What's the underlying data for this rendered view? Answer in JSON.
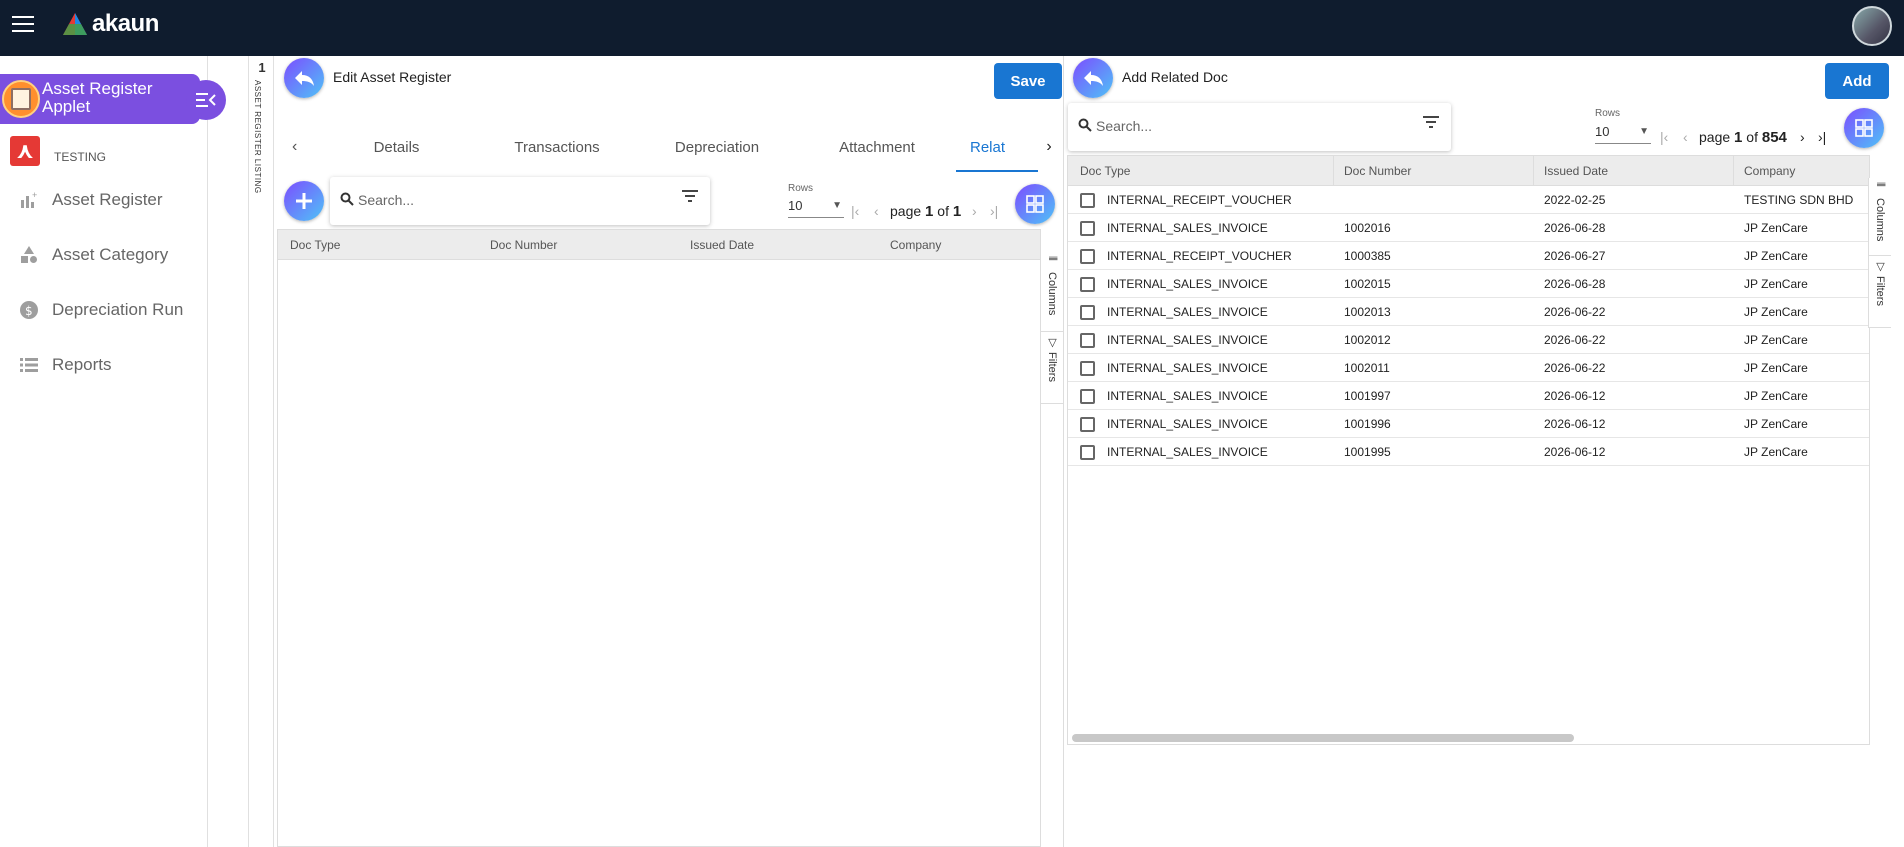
{
  "topbar": {
    "logo_text": "akaun"
  },
  "sidebar": {
    "applet_title_line1": "Asset Register",
    "applet_title_line2": "Applet",
    "org_name": "TESTING",
    "items": [
      {
        "label": "Asset Register",
        "icon": "chart-add-icon"
      },
      {
        "label": "Asset Category",
        "icon": "shapes-icon"
      },
      {
        "label": "Depreciation Run",
        "icon": "dollar-circle-icon"
      },
      {
        "label": "Reports",
        "icon": "list-icon"
      }
    ]
  },
  "listing_strip": {
    "number": "1",
    "label": "ASSET REGISTER LISTING"
  },
  "edit_panel": {
    "title": "Edit Asset Register",
    "save_label": "Save",
    "tabs": [
      "Details",
      "Transactions",
      "Depreciation",
      "Attachment",
      "Relat"
    ],
    "search_placeholder": "Search...",
    "rows_label": "Rows",
    "rows_value": "10",
    "page_word": "page",
    "page_current": "1",
    "of_word": "of",
    "page_total": "1",
    "columns": [
      "Doc Type",
      "Doc Number",
      "Issued Date",
      "Company"
    ],
    "side_tools": [
      "Columns",
      "Filters"
    ]
  },
  "related_panel": {
    "title": "Add Related Doc",
    "add_label": "Add",
    "search_placeholder": "Search...",
    "rows_label": "Rows",
    "rows_value": "10",
    "page_word": "page",
    "page_current": "1",
    "of_word": "of",
    "page_total": "854",
    "columns": [
      "Doc Type",
      "Doc Number",
      "Issued Date",
      "Company"
    ],
    "side_tools": [
      "Columns",
      "Filters"
    ],
    "rows": [
      {
        "doc_type": "INTERNAL_RECEIPT_VOUCHER",
        "doc_number": "",
        "issued_date": "2022-02-25",
        "company": "TESTING SDN BHD"
      },
      {
        "doc_type": "INTERNAL_SALES_INVOICE",
        "doc_number": "1002016",
        "issued_date": "2026-06-28",
        "company": "JP ZenCare"
      },
      {
        "doc_type": "INTERNAL_RECEIPT_VOUCHER",
        "doc_number": "1000385",
        "issued_date": "2026-06-27",
        "company": "JP ZenCare"
      },
      {
        "doc_type": "INTERNAL_SALES_INVOICE",
        "doc_number": "1002015",
        "issued_date": "2026-06-28",
        "company": "JP ZenCare"
      },
      {
        "doc_type": "INTERNAL_SALES_INVOICE",
        "doc_number": "1002013",
        "issued_date": "2026-06-22",
        "company": "JP ZenCare"
      },
      {
        "doc_type": "INTERNAL_SALES_INVOICE",
        "doc_number": "1002012",
        "issued_date": "2026-06-22",
        "company": "JP ZenCare"
      },
      {
        "doc_type": "INTERNAL_SALES_INVOICE",
        "doc_number": "1002011",
        "issued_date": "2026-06-22",
        "company": "JP ZenCare"
      },
      {
        "doc_type": "INTERNAL_SALES_INVOICE",
        "doc_number": "1001997",
        "issued_date": "2026-06-12",
        "company": "JP ZenCare"
      },
      {
        "doc_type": "INTERNAL_SALES_INVOICE",
        "doc_number": "1001996",
        "issued_date": "2026-06-12",
        "company": "JP ZenCare"
      },
      {
        "doc_type": "INTERNAL_SALES_INVOICE",
        "doc_number": "1001995",
        "issued_date": "2026-06-12",
        "company": "JP ZenCare"
      }
    ]
  }
}
